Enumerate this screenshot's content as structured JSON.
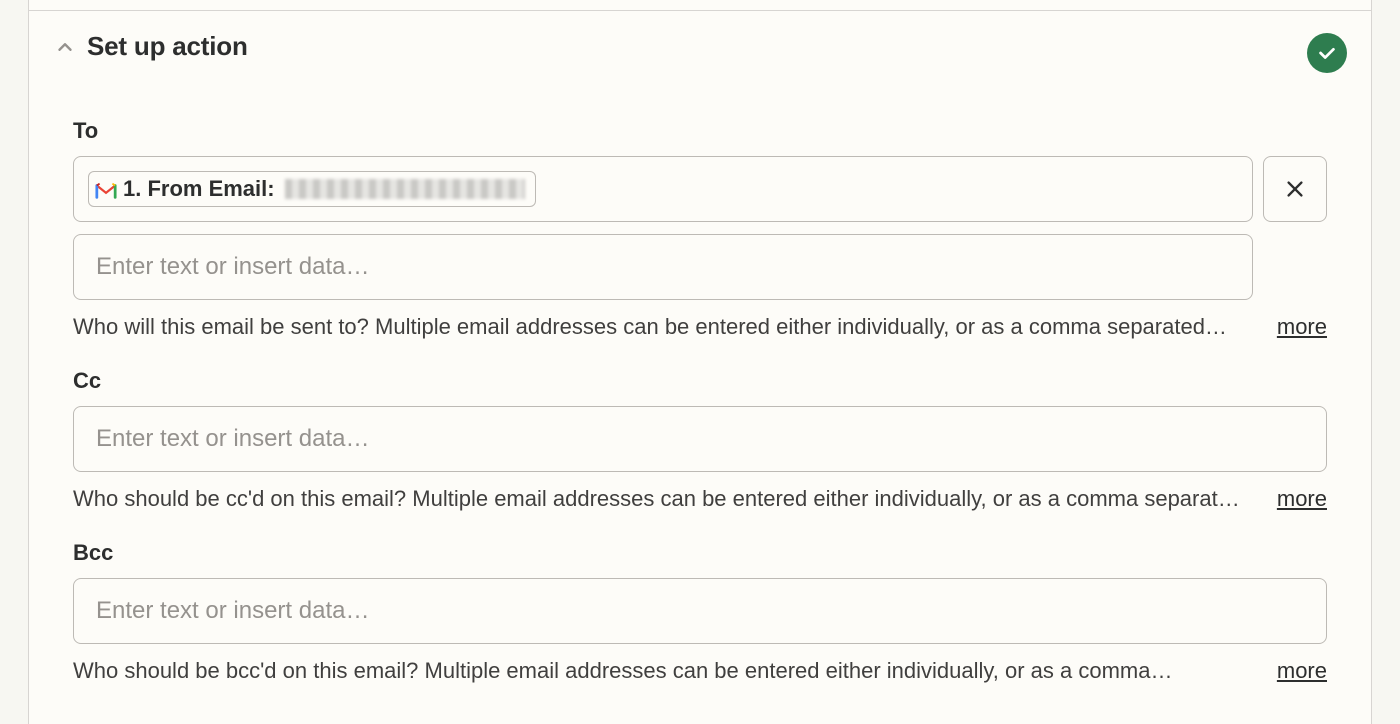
{
  "section": {
    "title": "Set up action",
    "status": "complete"
  },
  "fields": {
    "to": {
      "label": "To",
      "pill_prefix": "1. From Email:",
      "placeholder": "Enter text or insert data…",
      "help": "Who will this email be sent to? Multiple email addresses can be entered either individually, or as a comma separated…",
      "more": "more"
    },
    "cc": {
      "label": "Cc",
      "placeholder": "Enter text or insert data…",
      "help": "Who should be cc'd on this email? Multiple email addresses can be entered either individually, or as a comma separat…",
      "more": "more"
    },
    "bcc": {
      "label": "Bcc",
      "placeholder": "Enter text or insert data…",
      "help": "Who should be bcc'd on this email? Multiple email addresses can be entered either individually, or as a comma…",
      "more": "more"
    }
  }
}
